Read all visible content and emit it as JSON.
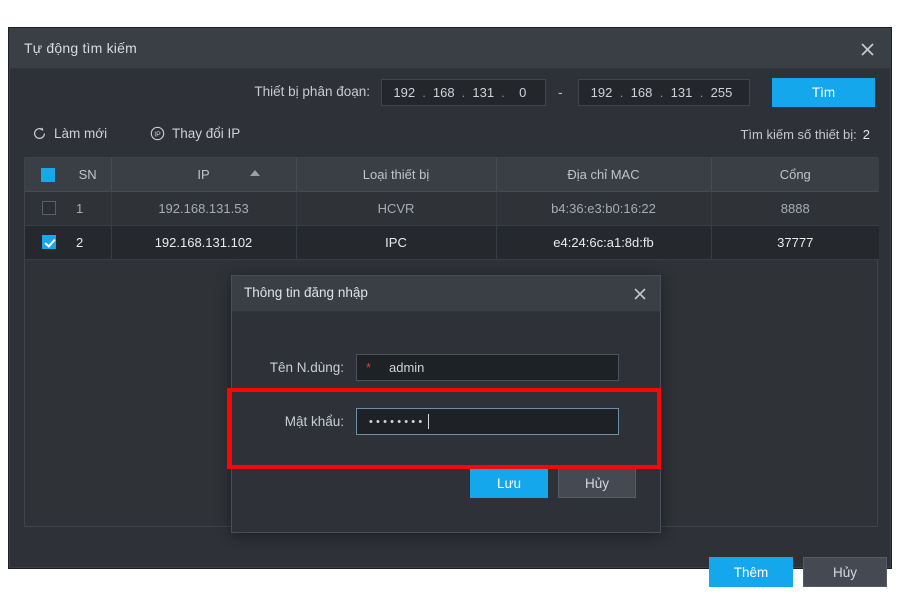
{
  "window": {
    "title": "Tự động tìm kiếm",
    "close_icon": "close-icon"
  },
  "search": {
    "segment_label": "Thiết bị phân đoạn:",
    "range_start": [
      "192",
      "168",
      "131",
      "0"
    ],
    "range_end": [
      "192",
      "168",
      "131",
      "255"
    ],
    "separator": "-",
    "search_button": "Tìm"
  },
  "toolbar": {
    "refresh_label": "Làm mới",
    "refresh_icon": "refresh-icon",
    "change_ip_label": "Thay đổi IP",
    "change_ip_icon": "ip-icon",
    "found_label": "Tìm kiếm số thiết bị:",
    "found_count": "2"
  },
  "table": {
    "headers": [
      "SN",
      "IP",
      "Loại thiết bị",
      "Địa chỉ MAC",
      "Cổng"
    ],
    "sort_column": "IP",
    "sort_direction": "asc",
    "header_checkbox_checked": true,
    "rows": [
      {
        "checked": false,
        "sn": "1",
        "ip": "192.168.131.53",
        "type": "HCVR",
        "mac": "b4:36:e3:b0:16:22",
        "port": "8888",
        "selected": false
      },
      {
        "checked": true,
        "sn": "2",
        "ip": "192.168.131.102",
        "type": "IPC",
        "mac": "e4:24:6c:a1:8d:fb",
        "port": "37777",
        "selected": true
      }
    ]
  },
  "footer": {
    "add_button": "Thêm",
    "cancel_button": "Hủy"
  },
  "modal": {
    "title": "Thông tin đăng nhập",
    "close_icon": "close-icon",
    "username": {
      "label": "Tên N.dùng:",
      "value": "admin",
      "required_marker": "*"
    },
    "password": {
      "label": "Mật khẩu:",
      "value": "••••••••",
      "masked_char_count": 8
    },
    "save_button": "Lưu",
    "cancel_button": "Hủy"
  },
  "annotation": {
    "highlight_color": "#f90606"
  },
  "colors": {
    "accent": "#14a7ec",
    "window_bg": "#2e3238",
    "titlebar_bg": "#3a3f46",
    "row_selected_bg": "#25282d",
    "text_primary": "#d8dce1",
    "required_red": "#e03b3b"
  }
}
